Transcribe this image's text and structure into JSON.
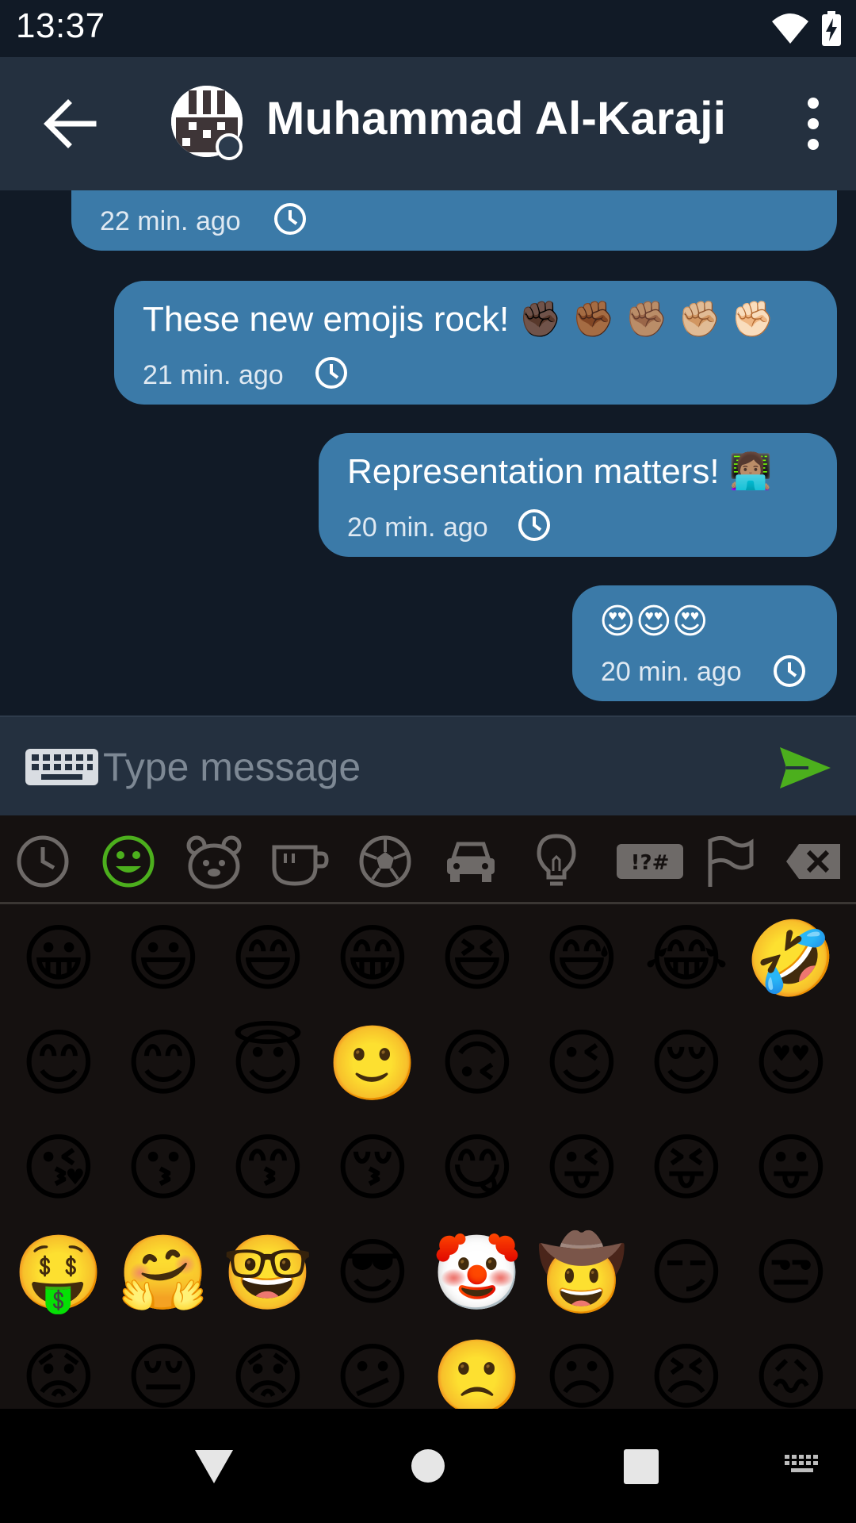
{
  "status_bar": {
    "time": "13:37",
    "wifi_icon": "wifi-icon",
    "battery_icon": "battery-charging-icon"
  },
  "toolbar": {
    "back_icon": "arrow-left-icon",
    "contact_name": "Muhammad Al-Karaji",
    "menu_icon": "more-vert-icon"
  },
  "messages": [
    {
      "text": "",
      "time": "22 min. ago",
      "status_icon": "clock-icon"
    },
    {
      "text": "These new emojis rock! ✊🏿 ✊🏾 ✊🏽 ✊🏼 ✊🏻",
      "time": "21 min. ago",
      "status_icon": "clock-icon"
    },
    {
      "text": "Representation matters! 👩🏽‍💻",
      "time": "20 min. ago",
      "status_icon": "clock-icon"
    },
    {
      "text": "😍😍😍",
      "time": "20 min. ago",
      "status_icon": "clock-icon"
    }
  ],
  "input": {
    "placeholder": "Type message",
    "value": "",
    "keyboard_icon": "keyboard-icon",
    "send_icon": "send-icon"
  },
  "emoji_categories": [
    {
      "name": "recent",
      "icon": "clock-icon"
    },
    {
      "name": "smileys",
      "icon": "smiley-icon",
      "selected": true
    },
    {
      "name": "animals",
      "icon": "bear-icon"
    },
    {
      "name": "food",
      "icon": "cup-icon"
    },
    {
      "name": "activity",
      "icon": "soccer-ball-icon"
    },
    {
      "name": "travel",
      "icon": "car-icon"
    },
    {
      "name": "objects",
      "icon": "lightbulb-icon"
    },
    {
      "name": "symbols",
      "icon": "symbols-icon",
      "label": "!?#"
    },
    {
      "name": "flags",
      "icon": "flag-icon"
    },
    {
      "name": "backspace",
      "icon": "backspace-icon"
    }
  ],
  "emojis": [
    "😀",
    "😃",
    "😄",
    "😁",
    "😆",
    "😅",
    "😂",
    "🤣",
    "😊",
    "😊",
    "😇",
    "🙂",
    "🙃",
    "😉",
    "😌",
    "😍",
    "😘",
    "😗",
    "😙",
    "😚",
    "😋",
    "😜",
    "😝",
    "😛",
    "🤑",
    "🤗",
    "🤓",
    "😎",
    "🤡",
    "🤠",
    "😏",
    "😒",
    "😟",
    "😔",
    "😟",
    "😕",
    "🙁",
    "☹",
    "😣",
    "😖"
  ],
  "nav_bar": {
    "back_icon": "nav-back-icon",
    "home_icon": "nav-home-icon",
    "recents_icon": "nav-recents-icon",
    "keyboard_icon": "keyboard-switch-icon"
  },
  "colors": {
    "bubble": "#3b7aa8",
    "accent_green": "#4caf1d",
    "toolbar": "#24303f",
    "background": "#111a26"
  }
}
